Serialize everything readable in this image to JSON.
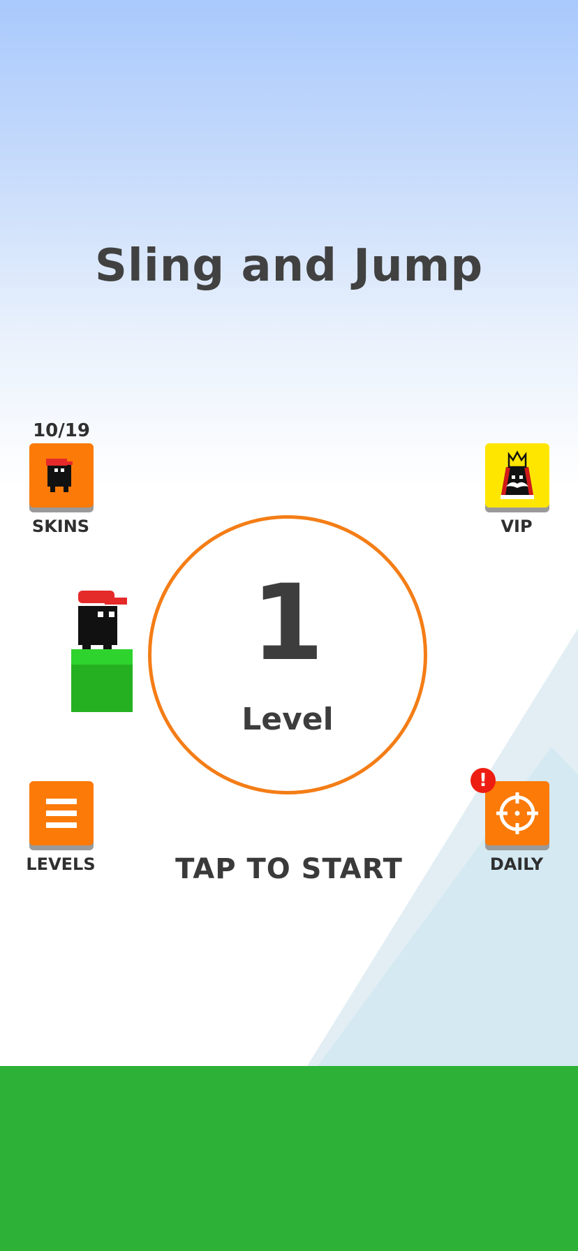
{
  "title": "Sling and Jump",
  "skins": {
    "count": "10/19",
    "label": "SKINS",
    "icon": "ninja-character-icon"
  },
  "vip": {
    "label": "VIP",
    "icon": "king-crown-icon"
  },
  "level": {
    "number": "1",
    "word": "Level"
  },
  "levels": {
    "label": "LEVELS",
    "icon": "menu-lines-icon"
  },
  "daily": {
    "label": "DAILY",
    "icon": "crosshair-icon",
    "badge": "!"
  },
  "tap_to_start": "TAP TO START",
  "colors": {
    "accent": "#fb7a08",
    "vip": "#ffe600",
    "ground": "#2db136",
    "badge": "#ee1d12"
  }
}
